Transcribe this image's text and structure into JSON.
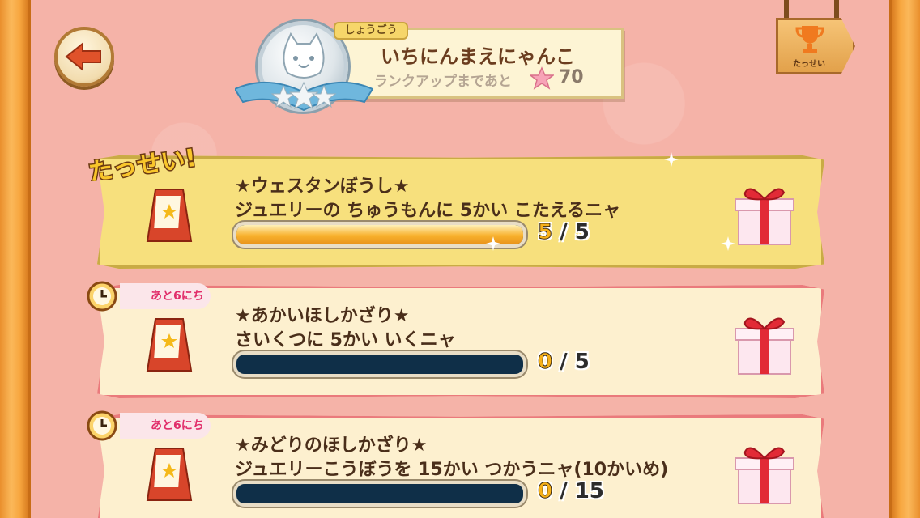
{
  "header": {
    "back_button": "back-arrow",
    "title_label": "しょうごう",
    "title_name": "いちにんまえにゃんこ",
    "rank_up_text": "ランクアップまであと",
    "rank_up_remaining": "70",
    "achievements_label": "たっせい"
  },
  "missions": [
    {
      "status_text": "たっせい!",
      "title": "★ウェスタンぼうし★",
      "description": "ジュエリーの ちゅうもんに 5かい こたえるニャ",
      "progress": 5,
      "goal": 5,
      "current_display": "5",
      "separator": "/",
      "goal_display": "5",
      "completed": true
    },
    {
      "timer_text": "あと6にち",
      "title": "★あかいほしかざり★",
      "description": "さいくつに 5かい いくニャ",
      "progress": 0,
      "goal": 5,
      "current_display": "0",
      "separator": "/",
      "goal_display": "5",
      "completed": false
    },
    {
      "timer_text": "あと6にち",
      "title": "★みどりのほしかざり★",
      "description": "ジュエリーこうぼうを 15かい つかうニャ(10かいめ)",
      "progress": 0,
      "goal": 15,
      "current_display": "0",
      "separator": "/",
      "goal_display": "15",
      "completed": false
    }
  ],
  "colors": {
    "background": "#f5b3a8",
    "frame": "#f7a63f",
    "card_done": "#f7e07d",
    "card_active": "#fdf0cf",
    "card_border": "#ea7a7c",
    "progress_fill": "#f8b12d",
    "progress_empty": "#0f2f48",
    "timer_text": "#e12d6a"
  }
}
